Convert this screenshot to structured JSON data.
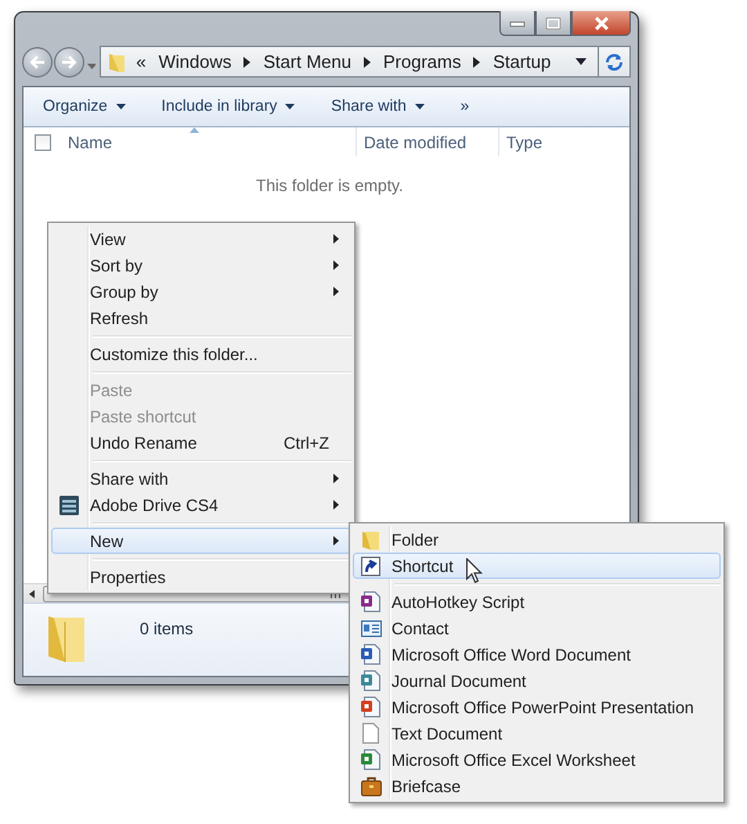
{
  "address_bar": {
    "overflow": "«",
    "crumbs": [
      "Windows",
      "Start Menu",
      "Programs",
      "Startup"
    ]
  },
  "toolbar": {
    "buttons": [
      {
        "label": "Organize",
        "dropdown": true
      },
      {
        "label": "Include in library",
        "dropdown": true
      },
      {
        "label": "Share with",
        "dropdown": true
      },
      {
        "label": "»",
        "dropdown": false
      }
    ]
  },
  "select_all": {
    "checked": false
  },
  "columns": [
    "Name",
    "Date modified",
    "Type"
  ],
  "empty_message": "This folder is empty.",
  "context_menu": [
    {
      "label": "View",
      "submenu": true,
      "disabled": false,
      "selected": false,
      "separator_before": false,
      "icon": false
    },
    {
      "label": "Sort by",
      "submenu": true,
      "disabled": false,
      "selected": false,
      "separator_before": false,
      "icon": false
    },
    {
      "label": "Group by",
      "submenu": true,
      "disabled": false,
      "selected": false,
      "separator_before": false,
      "icon": false
    },
    {
      "label": "Refresh",
      "submenu": false,
      "disabled": false,
      "selected": false,
      "separator_before": false,
      "icon": false
    },
    {
      "label": "Customize this folder...",
      "submenu": false,
      "disabled": false,
      "selected": false,
      "separator_before": true,
      "icon": false
    },
    {
      "label": "Paste",
      "submenu": false,
      "disabled": true,
      "selected": false,
      "separator_before": true,
      "icon": false
    },
    {
      "label": "Paste shortcut",
      "submenu": false,
      "disabled": true,
      "selected": false,
      "separator_before": false,
      "icon": false
    },
    {
      "label": "Undo Rename",
      "shortcut": "Ctrl+Z",
      "submenu": false,
      "disabled": false,
      "selected": false,
      "separator_before": false,
      "icon": false
    },
    {
      "label": "Share with",
      "submenu": true,
      "disabled": false,
      "selected": false,
      "separator_before": true,
      "icon": false
    },
    {
      "label": "Adobe Drive CS4",
      "submenu": true,
      "disabled": false,
      "selected": false,
      "separator_before": false,
      "icon": true
    },
    {
      "label": "New",
      "submenu": true,
      "disabled": false,
      "selected": true,
      "separator_before": true,
      "icon": false
    },
    {
      "label": "Properties",
      "submenu": false,
      "disabled": false,
      "selected": false,
      "separator_before": true,
      "icon": false
    }
  ],
  "new_submenu": [
    {
      "label": "Folder",
      "kind": "folder",
      "selected": false,
      "separator_before": false
    },
    {
      "label": "Shortcut",
      "kind": "shortcut",
      "selected": true,
      "separator_before": false
    },
    {
      "label": "AutoHotkey Script",
      "kind": "script",
      "selected": false,
      "separator_before": true
    },
    {
      "label": "Contact",
      "kind": "contact",
      "selected": false,
      "separator_before": false
    },
    {
      "label": "Microsoft Office Word Document",
      "kind": "word",
      "selected": false,
      "separator_before": false
    },
    {
      "label": "Journal Document",
      "kind": "journal",
      "selected": false,
      "separator_before": false
    },
    {
      "label": "Microsoft Office PowerPoint Presentation",
      "kind": "powerpoint",
      "selected": false,
      "separator_before": false
    },
    {
      "label": "Text Document",
      "kind": "text",
      "selected": false,
      "separator_before": false
    },
    {
      "label": "Microsoft Office Excel Worksheet",
      "kind": "excel",
      "selected": false,
      "separator_before": false
    },
    {
      "label": "Briefcase",
      "kind": "briefcase",
      "selected": false,
      "separator_before": false
    }
  ],
  "status_bar": {
    "count": "0 items"
  }
}
